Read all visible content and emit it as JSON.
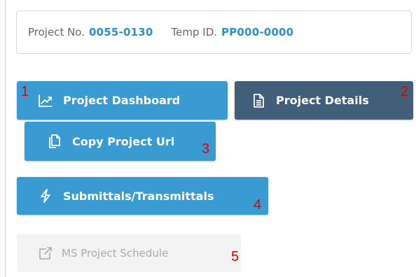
{
  "project_info": {
    "project_no_label": "Project No.",
    "project_no_value": "0055-0130",
    "temp_id_label": "Temp ID.",
    "temp_id_value": "PP000-0000"
  },
  "buttons": {
    "dashboard": "Project Dashboard",
    "details": "Project Details",
    "copy_url": "Copy Project Url",
    "submittals": "Submittals/Transmittals",
    "ms_project": "MS Project Schedule"
  },
  "annotations": [
    "1",
    "2",
    "3",
    "4",
    "5"
  ],
  "colors": {
    "primary": "#3a9bd3",
    "dark": "#415f79",
    "disabled_bg": "#f3f3f3",
    "annotation": "#e00000",
    "value_text": "#2a8fc7"
  },
  "icons": {
    "dashboard": "trend-chart-icon",
    "details": "document-icon",
    "copy_url": "copy-icon",
    "submittals": "lightning-icon",
    "ms_project": "external-link-icon"
  }
}
